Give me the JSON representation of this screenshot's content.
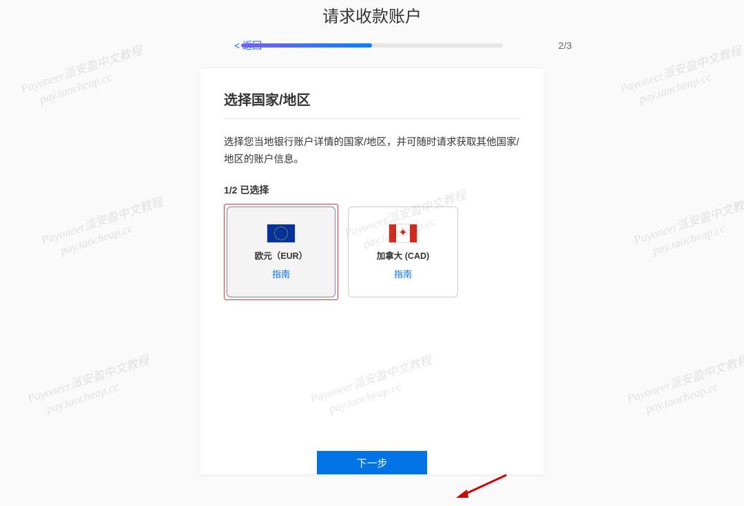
{
  "page_title": "请求收款账户",
  "back_label": "< 返回",
  "step_indicator": "2/3",
  "card": {
    "heading": "选择国家/地区",
    "description": "选择您当地银行账户详情的国家/地区，并可随时请求获取其他国家/地区的账户信息。",
    "selected_count": "1/2 已选择"
  },
  "currencies": [
    {
      "name": "欧元（EUR）",
      "guide": "指南",
      "flag": "eu",
      "selected": true
    },
    {
      "name": "加拿大 (CAD)",
      "guide": "指南",
      "flag": "ca",
      "selected": false
    }
  ],
  "next_button": "下一步",
  "watermark_text": "Payoneer派安盈中文教程\n     pay.taocheap.cc"
}
